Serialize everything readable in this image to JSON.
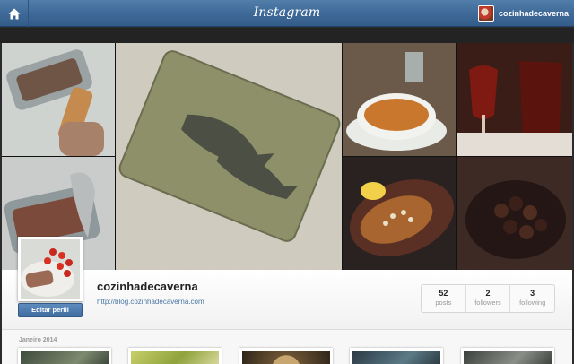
{
  "header": {
    "logo": "Instagram",
    "home_icon": "home-icon",
    "username": "cozinhadecaverna",
    "colors": {
      "bar_top": "#527eaa",
      "bar_bottom": "#335c88"
    }
  },
  "profile": {
    "name": "cozinhadecaverna",
    "link": "http://blog.cozinhadecaverna.com",
    "edit_button": "Editar perfil",
    "stats": [
      {
        "value": "52",
        "label": "posts"
      },
      {
        "value": "2",
        "label": "followers"
      },
      {
        "value": "3",
        "label": "following"
      }
    ]
  },
  "feed": {
    "month": "Janeiro 2014"
  }
}
